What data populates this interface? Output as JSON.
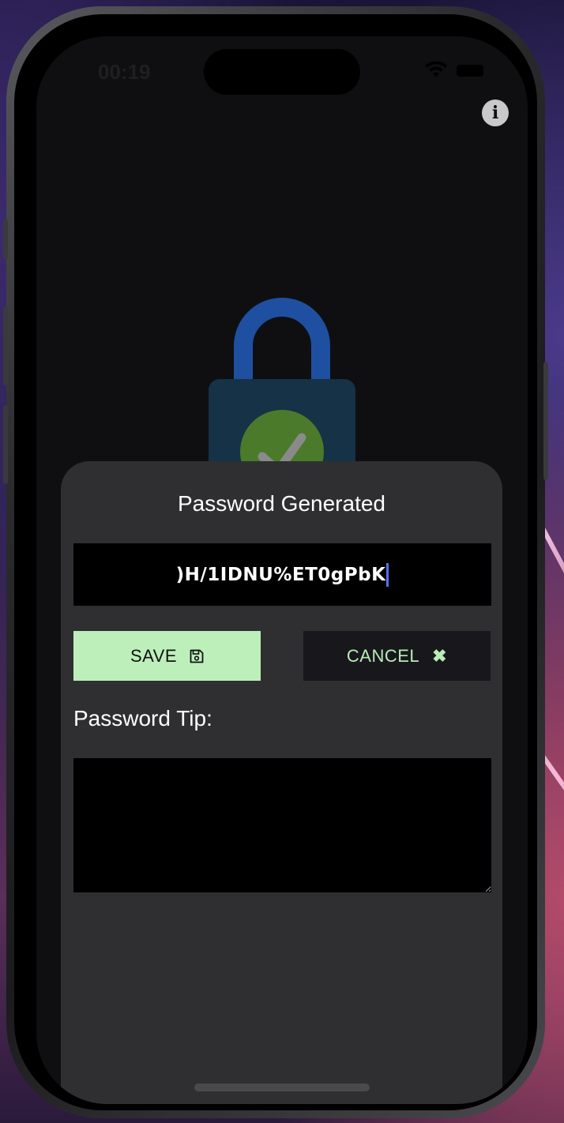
{
  "status_bar": {
    "time": "00:19"
  },
  "header": {
    "info_icon": "info-circle-icon",
    "info_glyph": "i"
  },
  "illustration": {
    "icon": "lock-checkmark-icon",
    "colors": {
      "shackle": "#1f4fa0",
      "body": "#163246",
      "check_circle": "#4a7a2a"
    }
  },
  "dialog": {
    "title": "Password Generated",
    "password_value": ")H/1IDNU%ET0gPbK",
    "save_label": "SAVE",
    "save_icon": "floppy-disk-icon",
    "cancel_label": "CANCEL",
    "cancel_icon": "close-x-icon",
    "cancel_glyph": "✖",
    "tip_label": "Password Tip:",
    "tip_value": ""
  },
  "colors": {
    "sheet_bg": "#2f2f31",
    "save_bg": "#bdefbb",
    "cancel_bg": "#18181c",
    "cancel_text": "#b9ecb8",
    "cursor": "#5b6ef2"
  }
}
